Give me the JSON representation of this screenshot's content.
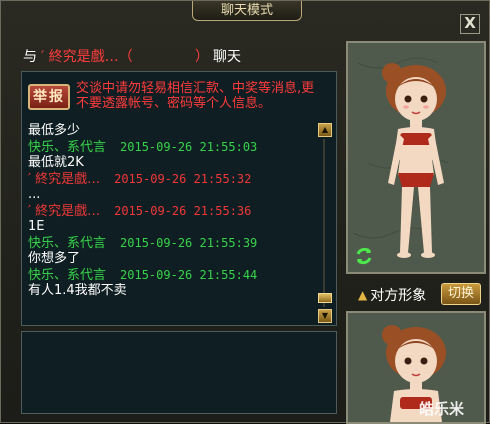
{
  "window": {
    "title": "聊天模式",
    "close_label": "X"
  },
  "header": {
    "prefix": "与",
    "target": "′ 終究是戲…（",
    "target_suffix": "）",
    "suffix": "聊天"
  },
  "report_button": "举报",
  "notice": "交谈中请勿轻易相信汇款、中奖等消息,更不要透露帐号、密码等个人信息。",
  "messages": [
    {
      "text": "最低多少",
      "ts": "",
      "color": "white"
    },
    {
      "text": "快乐、系代言",
      "ts": "2015-09-26 21:55:03",
      "color": "green"
    },
    {
      "text": "最低就2K",
      "ts": "",
      "color": "white"
    },
    {
      "text": "′ 終究是戲…",
      "ts": "2015-09-26 21:55:32",
      "color": "red"
    },
    {
      "text": "...",
      "ts": "",
      "color": "white"
    },
    {
      "text": "′ 終究是戲…",
      "ts": "2015-09-26 21:55:36",
      "color": "red"
    },
    {
      "text": "1E",
      "ts": "",
      "color": "white"
    },
    {
      "text": "快乐、系代言",
      "ts": "2015-09-26 21:55:39",
      "color": "green"
    },
    {
      "text": "你想多了",
      "ts": "",
      "color": "white"
    },
    {
      "text": "快乐、系代言",
      "ts": "2015-09-26 21:55:44",
      "color": "green"
    },
    {
      "text": "有人1.4我都不卖",
      "ts": "",
      "color": "white"
    }
  ],
  "side": {
    "opponent_label": "对方形象",
    "swap_button": "切换"
  },
  "watermark": "皓乐米",
  "colors": {
    "green": "#36d44a",
    "red": "#f03838",
    "gold": "#e2b642"
  },
  "icons": {
    "close": "close-icon",
    "rotate": "rotate-icon",
    "up": "up-arrow-icon",
    "scroll_up": "scroll-up-icon",
    "scroll_down": "scroll-down-icon"
  }
}
